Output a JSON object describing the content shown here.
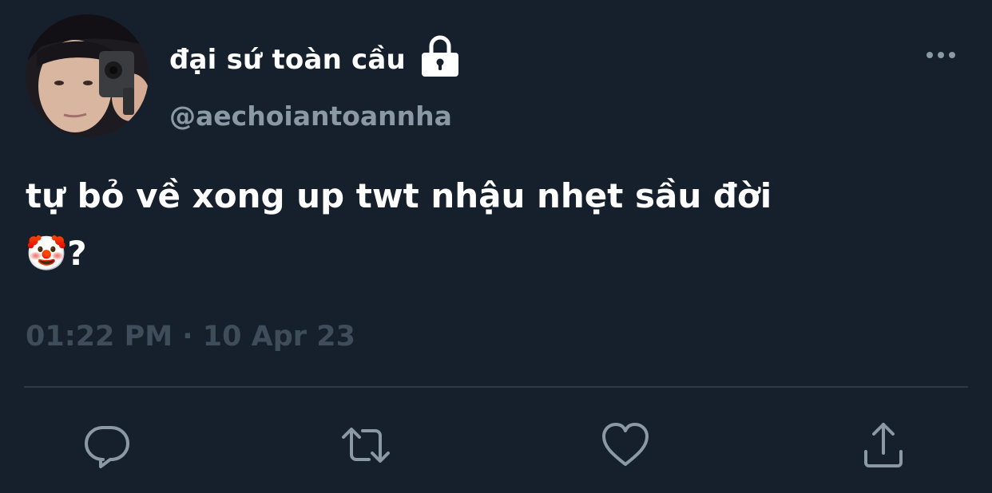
{
  "tweet": {
    "display_name": "đại sứ toàn cầu",
    "handle": "@aechoiantoannha",
    "text": "tự bỏ về xong up twt nhậu nhẹt sầu đời\n🤡?",
    "timestamp": "01:22 PM · 10 Apr 23",
    "protected_icon": "lock-icon"
  },
  "menu": {
    "more_icon": "more-horizontal-icon"
  },
  "actions": [
    {
      "name": "reply",
      "icon": "reply-icon"
    },
    {
      "name": "retweet",
      "icon": "retweet-icon"
    },
    {
      "name": "like",
      "icon": "heart-icon"
    },
    {
      "name": "share",
      "icon": "share-icon"
    }
  ],
  "colors": {
    "background": "#16202c",
    "primary_text": "#ffffff",
    "secondary_text": "#8b98a5",
    "icon": "#8b98a5",
    "divider": "#2f3a46"
  }
}
